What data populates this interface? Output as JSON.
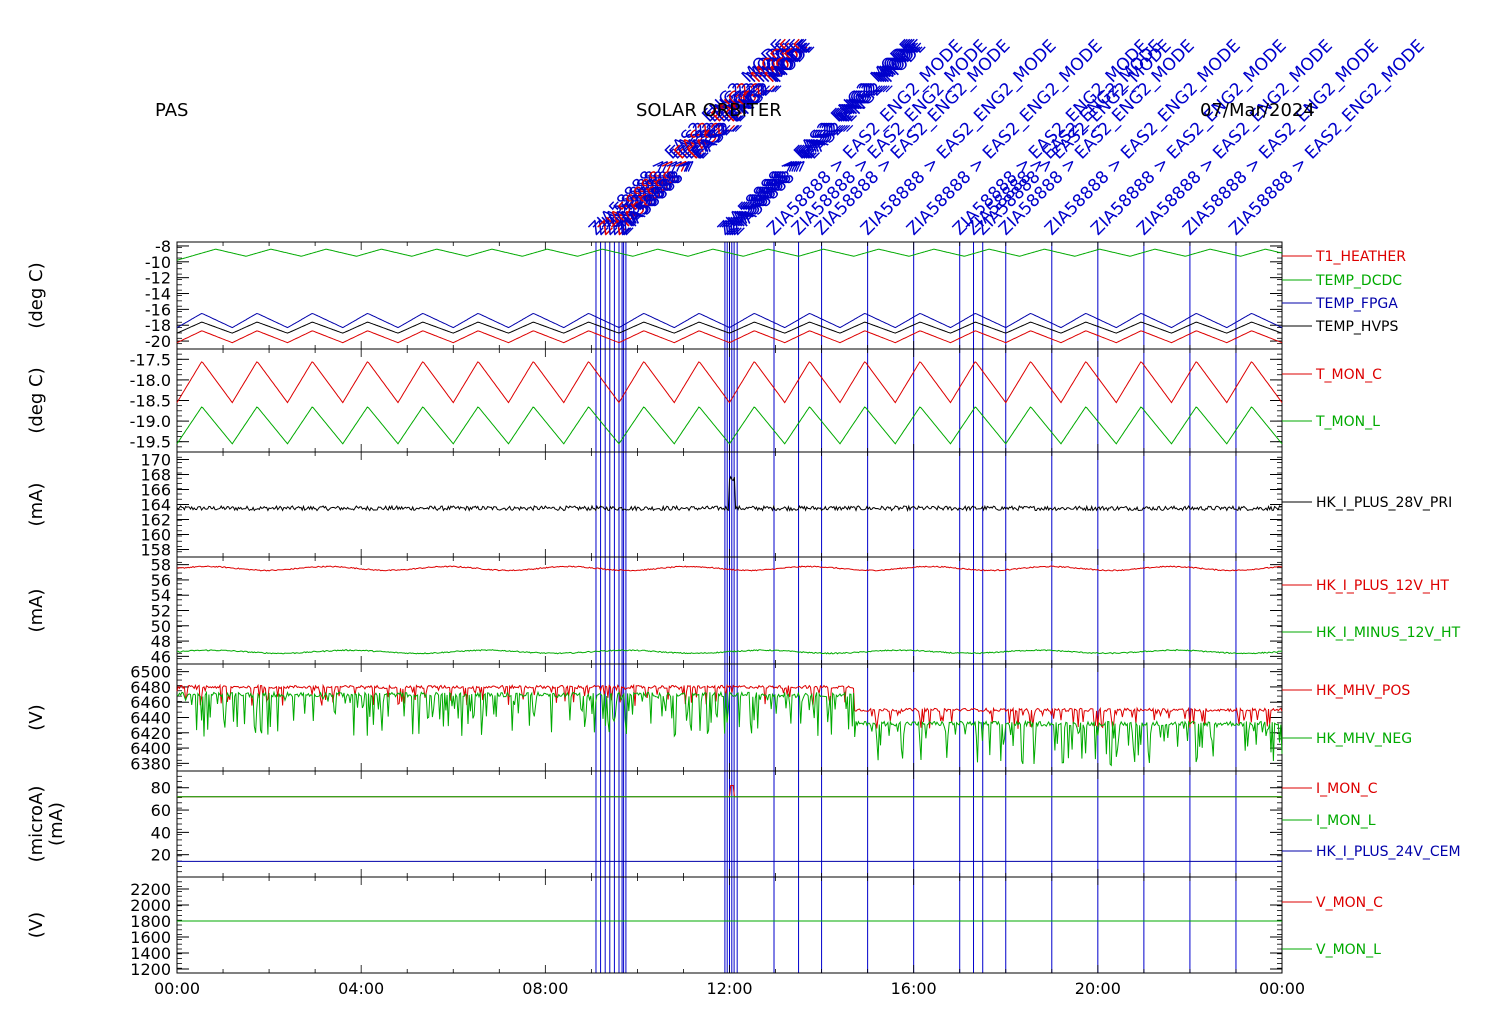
{
  "header": {
    "instrument": "PAS",
    "mission": "SOLAR ORBITER",
    "date": "07/Mar/2024"
  },
  "event_annotations": {
    "text": "ZIA58888 > EAS2_ENG2_MODE",
    "times": [
      "09:06",
      "09:12",
      "09:18",
      "09:24",
      "09:30",
      "09:36",
      "09:40",
      "09:42",
      "09:45",
      "11:54",
      "11:57",
      "12:00",
      "12:03",
      "12:06",
      "12:10",
      "12:58",
      "13:30",
      "14:00",
      "15:00",
      "16:00",
      "17:00",
      "17:18",
      "17:30",
      "18:00",
      "19:00",
      "20:00",
      "21:00",
      "22:00",
      "23:00"
    ],
    "color": "#0000cc",
    "red_color": "#dd0000"
  },
  "colors": {
    "red": "#dd0000",
    "green": "#00aa00",
    "blue": "#0000aa",
    "black": "#000000"
  },
  "x_axis": {
    "ticks": [
      "00:00",
      "04:00",
      "08:00",
      "12:00",
      "16:00",
      "20:00",
      "00:00"
    ],
    "range_hours": [
      0,
      24
    ]
  },
  "panels": [
    {
      "id": "temperatures",
      "ylabel": "(deg C)",
      "ylim": [
        -21,
        -7.5
      ],
      "yticks": [
        "-8",
        "-10",
        "-12",
        "-14",
        "-16",
        "-18",
        "-20"
      ],
      "tick_values": [
        -8,
        -10,
        -12,
        -14,
        -16,
        -18,
        -20
      ],
      "series": [
        {
          "name": "T1_HEATHER",
          "color": "red"
        },
        {
          "name": "TEMP_DCDC",
          "color": "green"
        },
        {
          "name": "TEMP_FPGA",
          "color": "blue"
        },
        {
          "name": "TEMP_HVPS",
          "color": "black"
        }
      ]
    },
    {
      "id": "tmon",
      "ylabel": "(deg C)",
      "ylim": [
        -19.75,
        -17.25
      ],
      "yticks": [
        "-17.5",
        "-18.0",
        "-18.5",
        "-19.0",
        "-19.5"
      ],
      "tick_values": [
        -17.5,
        -18.0,
        -18.5,
        -19.0,
        -19.5
      ],
      "series": [
        {
          "name": "T_MON_C",
          "color": "red"
        },
        {
          "name": "T_MON_L",
          "color": "green"
        }
      ]
    },
    {
      "id": "i28",
      "ylabel": "(mA)",
      "ylim": [
        157,
        171
      ],
      "yticks": [
        "170",
        "168",
        "166",
        "164",
        "162",
        "160",
        "158"
      ],
      "tick_values": [
        170,
        168,
        166,
        164,
        162,
        160,
        158
      ],
      "series": [
        {
          "name": "HK_I_PLUS_28V_PRI",
          "color": "black"
        }
      ]
    },
    {
      "id": "i12",
      "ylabel": "(mA)",
      "ylim": [
        45,
        59
      ],
      "yticks": [
        "58",
        "56",
        "54",
        "52",
        "50",
        "48",
        "46"
      ],
      "tick_values": [
        58,
        56,
        54,
        52,
        50,
        48,
        46
      ],
      "series": [
        {
          "name": "HK_I_PLUS_12V_HT",
          "color": "red"
        },
        {
          "name": "HK_I_MINUS_12V_HT",
          "color": "green"
        }
      ]
    },
    {
      "id": "mhv",
      "ylabel": "(V)",
      "ylim": [
        6370,
        6510
      ],
      "yticks": [
        "6500",
        "6480",
        "6460",
        "6440",
        "6420",
        "6400",
        "6380"
      ],
      "tick_values": [
        6500,
        6480,
        6460,
        6440,
        6420,
        6400,
        6380
      ],
      "series": [
        {
          "name": "HK_MHV_POS",
          "color": "red"
        },
        {
          "name": "HK_MHV_NEG",
          "color": "green"
        }
      ]
    },
    {
      "id": "imon",
      "ylabel": "(microA)",
      "ylabel2": "(mA)",
      "ylim": [
        0,
        95
      ],
      "yticks": [
        "80",
        "60",
        "40",
        "20"
      ],
      "tick_values": [
        80,
        60,
        40,
        20
      ],
      "series": [
        {
          "name": "I_MON_C",
          "color": "red"
        },
        {
          "name": "I_MON_L",
          "color": "green"
        },
        {
          "name": "HK_I_PLUS_24V_CEM",
          "color": "blue"
        }
      ]
    },
    {
      "id": "vmon",
      "ylabel": "(V)",
      "ylim": [
        1150,
        2350
      ],
      "yticks": [
        "2200",
        "2000",
        "1800",
        "1600",
        "1400",
        "1200"
      ],
      "tick_values": [
        2200,
        2000,
        1800,
        1600,
        1400,
        1200
      ],
      "series": [
        {
          "name": "V_MON_C",
          "color": "red"
        },
        {
          "name": "V_MON_L",
          "color": "green"
        }
      ]
    }
  ],
  "chart_data": {
    "type": "line",
    "title": "",
    "x_range_hours": [
      0,
      24
    ],
    "approximate_levels": {
      "T1_HEATHER": [
        -20.5,
        -18.5
      ],
      "TEMP_DCDC": [
        -10,
        -8.5
      ],
      "TEMP_FPGA": [
        -19,
        -16.5
      ],
      "TEMP_HVPS": [
        -19.5,
        -17.5
      ],
      "T_MON_C": [
        -18.6,
        -17.5
      ],
      "T_MON_L": [
        -19.6,
        -18.7
      ],
      "HK_I_PLUS_28V_PRI": 163.5,
      "HK_I_PLUS_12V_HT": 57.5,
      "HK_I_MINUS_12V_HT": 46.5,
      "HK_MHV_POS": {
        "before_14h40": 6480,
        "after_14h40": 6450
      },
      "HK_MHV_NEG": {
        "before_14h40": 6460,
        "after_14h40": 6430
      },
      "I_MON_C": 72,
      "I_MON_L": 72,
      "HK_I_PLUS_24V_CEM": 14,
      "V_MON_C": 1800,
      "V_MON_L": 1800
    }
  }
}
